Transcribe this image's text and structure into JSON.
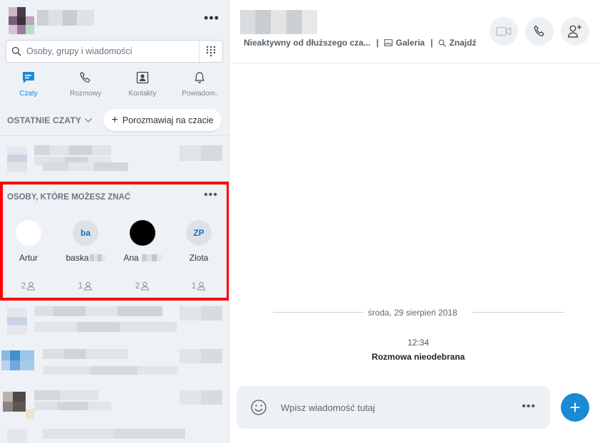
{
  "left": {
    "more_dots": "•••",
    "search": {
      "placeholder": "Osoby, grupy i wiadomości"
    },
    "nav": [
      {
        "label": "Czaty",
        "icon": "chat-icon",
        "active": true
      },
      {
        "label": "Rozmowy",
        "icon": "phone-icon"
      },
      {
        "label": "Kontakty",
        "icon": "contacts-icon"
      },
      {
        "label": "Powiadom.",
        "icon": "bell-icon"
      }
    ],
    "recent_header": "OSTATNIE CZATY",
    "new_chat_label": "Porozmawiaj na czacie",
    "suggestions": {
      "title": "OSOBY, KTÓRE MOŻESZ ZNAĆ",
      "more_dots": "•••",
      "people": [
        {
          "name": "Artur",
          "initials": "",
          "count": "2"
        },
        {
          "name": "baska",
          "initials": "ba",
          "count": "1"
        },
        {
          "name": "Ana",
          "initials": "",
          "count": "2"
        },
        {
          "name": "Zlota",
          "initials": "ZP",
          "count": "1"
        }
      ]
    }
  },
  "right": {
    "status": "Nieaktywny od dłuższego cza...",
    "gallery_label": "Galeria",
    "find_label": "Znajdź",
    "date_divider": "środa, 29 sierpień 2018",
    "time": "12:34",
    "event": "Rozmowa nieodebrana",
    "composer_placeholder": "Wpisz wiadomość tutaj",
    "composer_more": "•••",
    "fab_label": "+"
  },
  "colors": {
    "accent": "#1a8ad4",
    "highlight_border": "#ff0000",
    "panel_bg": "#eef1f5"
  }
}
